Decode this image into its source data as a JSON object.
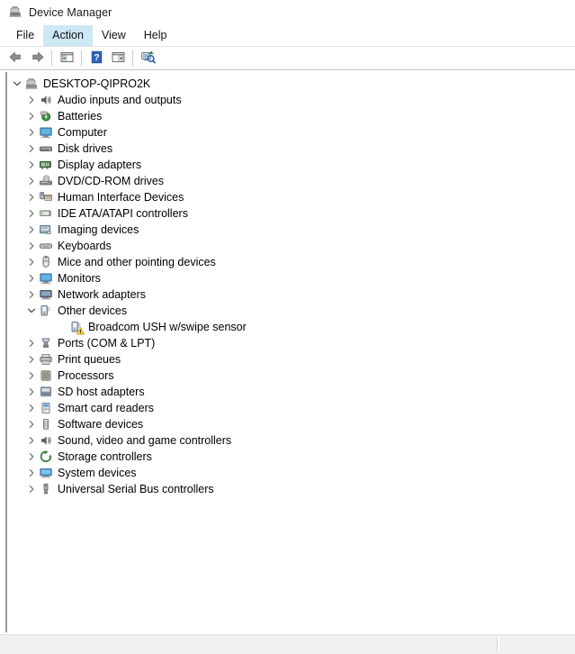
{
  "window": {
    "title": "Device Manager",
    "title_icon": "device-manager-icon"
  },
  "menubar": {
    "items": [
      {
        "label": "File",
        "hovered": false
      },
      {
        "label": "Action",
        "hovered": true
      },
      {
        "label": "View",
        "hovered": false
      },
      {
        "label": "Help",
        "hovered": false
      }
    ]
  },
  "toolbar": {
    "items": [
      {
        "type": "button",
        "icon": "back-arrow-icon",
        "name": "toolbar-back-button"
      },
      {
        "type": "button",
        "icon": "forward-arrow-icon",
        "name": "toolbar-forward-button"
      },
      {
        "type": "separator"
      },
      {
        "type": "button",
        "icon": "show-hide-console-tree-icon",
        "name": "toolbar-console-tree-button"
      },
      {
        "type": "separator"
      },
      {
        "type": "button",
        "icon": "help-icon",
        "name": "toolbar-help-button"
      },
      {
        "type": "button",
        "icon": "properties-icon",
        "name": "toolbar-properties-button"
      },
      {
        "type": "separator"
      },
      {
        "type": "button",
        "icon": "scan-for-hardware-changes-icon",
        "name": "toolbar-scan-hardware-button"
      }
    ]
  },
  "tree": {
    "nodes": [
      {
        "label": "DESKTOP-QIPRO2K",
        "level": 0,
        "state": "expanded",
        "icon": "computer-root-icon",
        "warning": false
      },
      {
        "label": "Audio inputs and outputs",
        "level": 1,
        "state": "collapsed",
        "icon": "audio-icon",
        "warning": false
      },
      {
        "label": "Batteries",
        "level": 1,
        "state": "collapsed",
        "icon": "battery-icon",
        "warning": false
      },
      {
        "label": "Computer",
        "level": 1,
        "state": "collapsed",
        "icon": "monitor-icon",
        "warning": false
      },
      {
        "label": "Disk drives",
        "level": 1,
        "state": "collapsed",
        "icon": "disk-drive-icon",
        "warning": false
      },
      {
        "label": "Display adapters",
        "level": 1,
        "state": "collapsed",
        "icon": "display-adapter-icon",
        "warning": false
      },
      {
        "label": "DVD/CD-ROM drives",
        "level": 1,
        "state": "collapsed",
        "icon": "dvd-drive-icon",
        "warning": false
      },
      {
        "label": "Human Interface Devices",
        "level": 1,
        "state": "collapsed",
        "icon": "hid-icon",
        "warning": false
      },
      {
        "label": "IDE ATA/ATAPI controllers",
        "level": 1,
        "state": "collapsed",
        "icon": "ide-controller-icon",
        "warning": false
      },
      {
        "label": "Imaging devices",
        "level": 1,
        "state": "collapsed",
        "icon": "imaging-device-icon",
        "warning": false
      },
      {
        "label": "Keyboards",
        "level": 1,
        "state": "collapsed",
        "icon": "keyboard-icon",
        "warning": false
      },
      {
        "label": "Mice and other pointing devices",
        "level": 1,
        "state": "collapsed",
        "icon": "mouse-icon",
        "warning": false
      },
      {
        "label": "Monitors",
        "level": 1,
        "state": "collapsed",
        "icon": "monitor-icon",
        "warning": false
      },
      {
        "label": "Network adapters",
        "level": 1,
        "state": "collapsed",
        "icon": "network-adapter-icon",
        "warning": false
      },
      {
        "label": "Other devices",
        "level": 1,
        "state": "expanded",
        "icon": "other-device-icon",
        "warning": false
      },
      {
        "label": "Broadcom USH w/swipe sensor",
        "level": 2,
        "state": "leaf",
        "icon": "other-device-icon",
        "warning": true
      },
      {
        "label": "Ports (COM & LPT)",
        "level": 1,
        "state": "collapsed",
        "icon": "port-icon",
        "warning": false
      },
      {
        "label": "Print queues",
        "level": 1,
        "state": "collapsed",
        "icon": "printer-icon",
        "warning": false
      },
      {
        "label": "Processors",
        "level": 1,
        "state": "collapsed",
        "icon": "processor-icon",
        "warning": false
      },
      {
        "label": "SD host adapters",
        "level": 1,
        "state": "collapsed",
        "icon": "sd-host-adapter-icon",
        "warning": false
      },
      {
        "label": "Smart card readers",
        "level": 1,
        "state": "collapsed",
        "icon": "smart-card-reader-icon",
        "warning": false
      },
      {
        "label": "Software devices",
        "level": 1,
        "state": "collapsed",
        "icon": "software-device-icon",
        "warning": false
      },
      {
        "label": "Sound, video and game controllers",
        "level": 1,
        "state": "collapsed",
        "icon": "audio-icon",
        "warning": false
      },
      {
        "label": "Storage controllers",
        "level": 1,
        "state": "collapsed",
        "icon": "storage-controller-icon",
        "warning": false
      },
      {
        "label": "System devices",
        "level": 1,
        "state": "collapsed",
        "icon": "system-device-icon",
        "warning": false
      },
      {
        "label": "Universal Serial Bus controllers",
        "level": 1,
        "state": "collapsed",
        "icon": "usb-icon",
        "warning": false
      }
    ]
  },
  "statusbar": {
    "left_text": "",
    "right_text": ""
  },
  "colors": {
    "menu_hover": "#cce8f4",
    "warning": "#ffd33a",
    "panel_border": "#9a9a9a",
    "statusbar_bg": "#f0f0f0"
  }
}
